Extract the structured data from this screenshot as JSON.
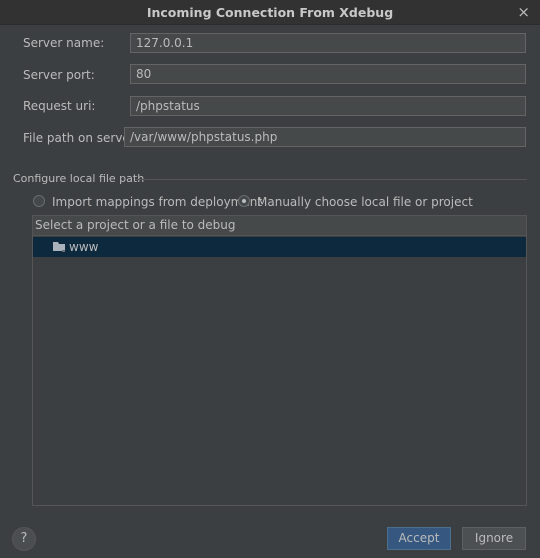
{
  "dialog": {
    "title": "Incoming Connection From Xdebug",
    "close_glyph": "×"
  },
  "form": {
    "server_name_label": "Server name:",
    "server_name_value": "127.0.0.1",
    "server_port_label": "Server port:",
    "server_port_value": "80",
    "request_uri_label": "Request uri:",
    "request_uri_value": "/phpstatus",
    "file_path_label": "File path on server:",
    "file_path_value": "/var/www/phpstatus.php"
  },
  "local_path": {
    "section_title": "Configure local file path",
    "option_import": "Import mappings from deployment",
    "option_manual": "Manually choose local file or project",
    "selected_option": "manual",
    "list_header": "Select a project or a file to debug",
    "items": [
      {
        "label": "www",
        "icon": "folder-icon",
        "selected": true
      }
    ]
  },
  "footer": {
    "help_label": "?",
    "accept_label": "Accept",
    "ignore_label": "Ignore"
  },
  "colors": {
    "background": "#3c3f41",
    "selection": "#0d293e",
    "accent_button": "#365880"
  }
}
